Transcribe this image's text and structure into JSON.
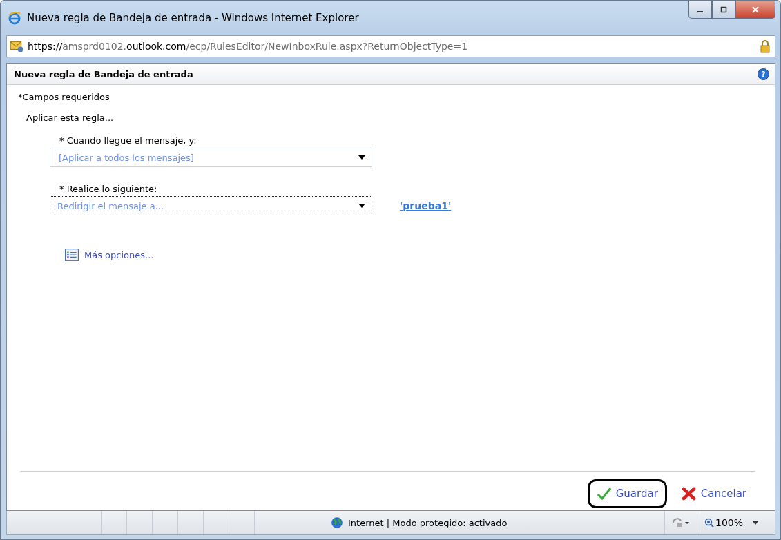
{
  "window": {
    "title": "Nueva regla de Bandeja de entrada - Windows Internet Explorer"
  },
  "address_bar": {
    "url": "**https://**amsprd0102.**outlook.com**/ecp/RulesEditor/NewInboxRule.aspx?ReturnObjectType=1"
  },
  "dialog": {
    "title": "Nueva regla de Bandeja de entrada",
    "help": "?",
    "required_note": "*Campos requeridos",
    "intro": "Aplicar esta regla...",
    "fields": [
      {
        "label": "* Cuando llegue el mensaje, y:",
        "value": "[Aplicar a todos los mensajes]",
        "focused": false
      },
      {
        "label": "* Realice lo siguiente:",
        "value": "Redirigir el mensaje a...",
        "focused": true,
        "link": "'prueba1'"
      }
    ],
    "more_options": "Más opciones...",
    "buttons": [
      {
        "kind": "save",
        "label": "Guardar",
        "highlighted": true
      },
      {
        "kind": "cancel",
        "label": "Cancelar",
        "highlighted": false
      }
    ]
  },
  "status_bar": {
    "zone": "Internet | Modo protegido: activado",
    "zoom": "100%"
  }
}
